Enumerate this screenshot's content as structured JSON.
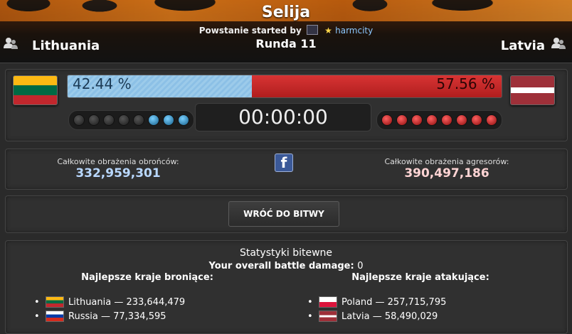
{
  "header": {
    "region": "Selija",
    "started_prefix": "Powstanie started by",
    "starter_name": "harmcity",
    "round": "Runda 11",
    "defender": "Lithuania",
    "attacker": "Latvia"
  },
  "battle": {
    "defender_percent": "42.44 %",
    "attacker_percent": "57.56 %",
    "defender_share": 0.4244,
    "timer": "00:00:00",
    "defender_rounds_won": 3,
    "attacker_rounds_won": 8,
    "rounds_total": 8
  },
  "damage": {
    "defender_label": "Całkowite obrażenia obrońców:",
    "defender_value": "332,959,301",
    "attacker_label": "Całkowite obrażenia agresorów:",
    "attacker_value": "390,497,186",
    "share_icon": "facebook-icon"
  },
  "actions": {
    "back_label": "WRÓĆ DO BITWY"
  },
  "stats": {
    "title": "Statystyki bitewne",
    "overall_label": "Your overall battle damage:",
    "overall_value": "0",
    "defenders_heading": "Najlepsze kraje broniące:",
    "attackers_heading": "Najlepsze kraje atakujące:",
    "defenders": [
      {
        "text": "Lithuania — 233,644,479"
      },
      {
        "text": "Russia — 77,334,595"
      }
    ],
    "attackers": [
      {
        "text": "Poland — 257,715,795"
      },
      {
        "text": "Latvia — 58,490,029"
      }
    ]
  },
  "colors": {
    "defender_bar": "#8cc0e6",
    "attacker_bar": "#c52b2b",
    "defender_value": "#b9d8ff",
    "attacker_value": "#ffd4d4"
  }
}
